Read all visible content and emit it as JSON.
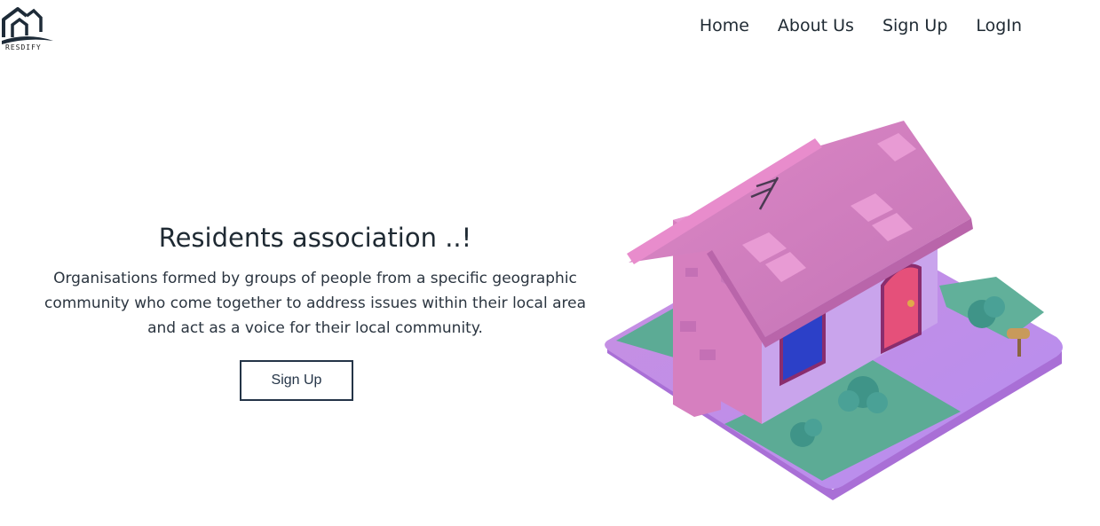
{
  "brand": {
    "name": "RESDIFY"
  },
  "nav": {
    "items": [
      "Home",
      "About Us",
      "Sign Up",
      "LogIn"
    ]
  },
  "hero": {
    "title": "Residents association ..!",
    "description_lines": [
      "Organisations formed by groups of people from a specific geographic",
      "community who come together to address issues within their local area",
      "and act as a voice for their local community."
    ],
    "cta_label": "Sign Up"
  },
  "colors": {
    "text": "#1f2a33",
    "button_border": "#243447",
    "house_pink": "#d67fbf",
    "roof_pink": "#cf7fb8",
    "lawn": "#5cab95",
    "base_lavender": "#d7a8e6"
  }
}
